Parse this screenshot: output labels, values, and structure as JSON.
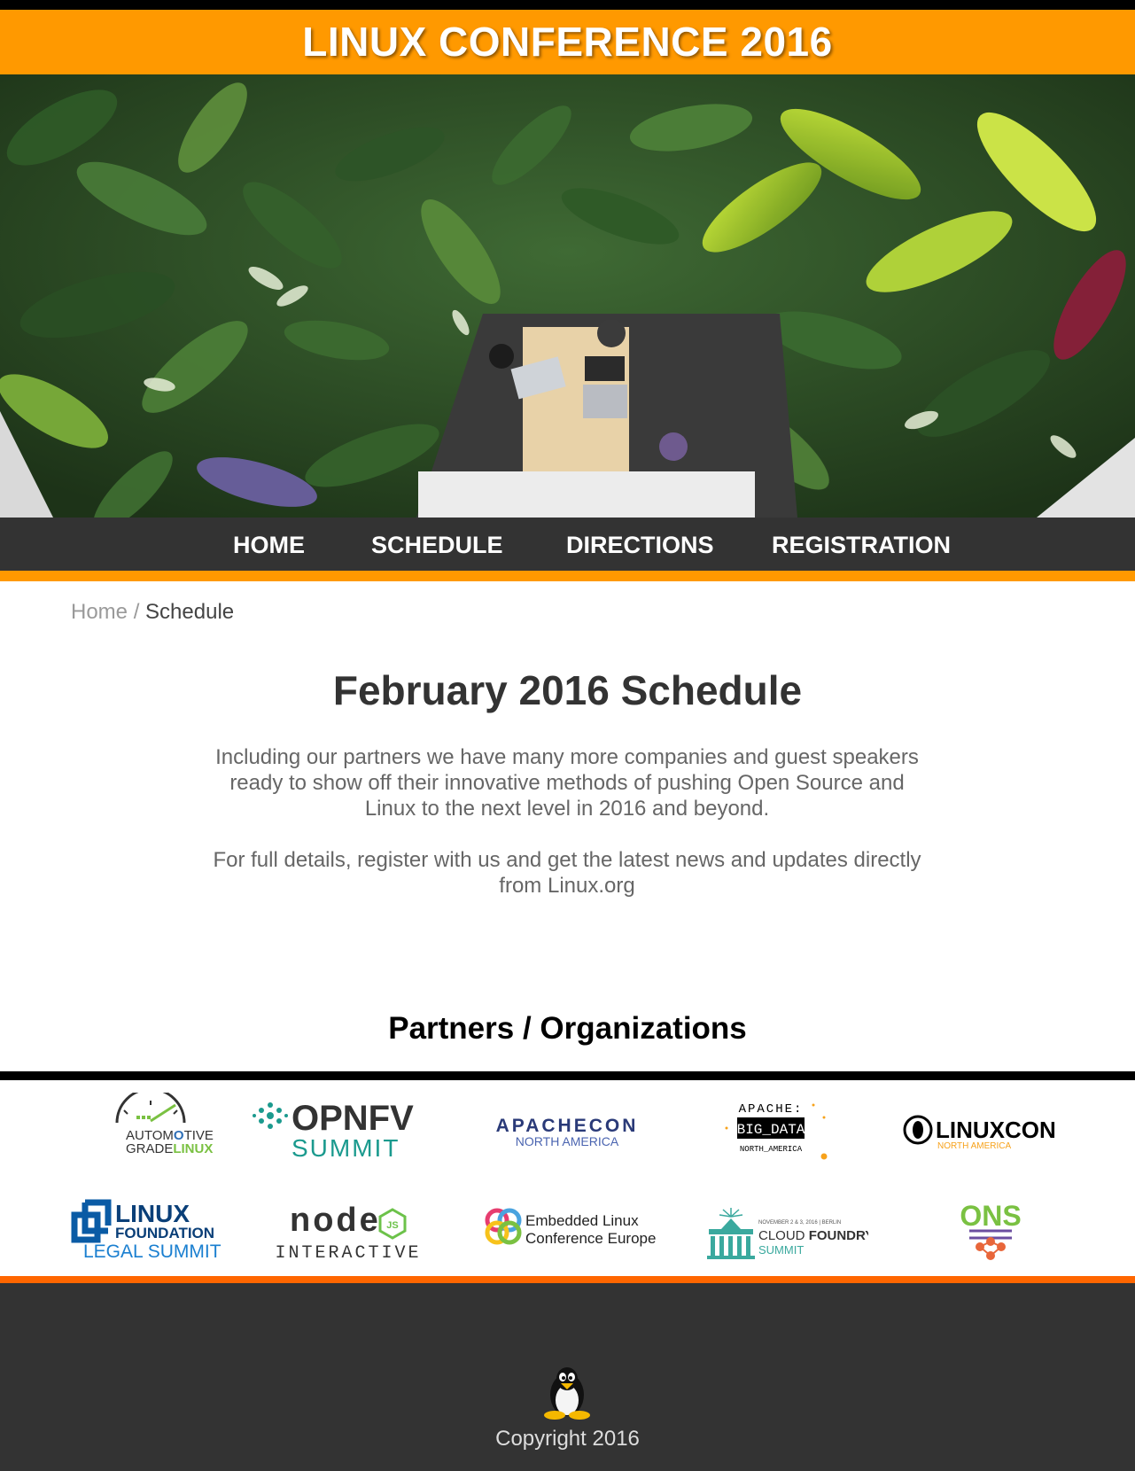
{
  "site": {
    "title": "LINUX CONFERENCE 2016"
  },
  "nav": {
    "items": [
      {
        "label": "HOME"
      },
      {
        "label": "SCHEDULE"
      },
      {
        "label": "DIRECTIONS"
      },
      {
        "label": "REGISTRATION"
      }
    ]
  },
  "breadcrumb": {
    "home": "Home",
    "separator": "/",
    "current": "Schedule"
  },
  "main": {
    "title": "February 2016 Schedule",
    "paragraphs": [
      "Including our partners we have many more companies and guest speakers ready to show off their innovative methods of pushing Open Source and Linux to the next level in 2016 and beyond.",
      "For full details, register with us and get the latest news and updates directly from Linux.org"
    ]
  },
  "partners": {
    "title": "Partners / Organizations",
    "logos": {
      "agl": {
        "line1a": "AUTOM",
        "line1b": "TIVE",
        "line2a": "GRADE",
        "line2b": "LINUX"
      },
      "opnfv": {
        "line1": "OPNFV",
        "line2": "SUMMIT"
      },
      "apachecon": {
        "line1": "APACHECON",
        "line2": "NORTH AMERICA"
      },
      "bigdata": {
        "line1": "APACHE:",
        "line2": "BIG_DATA",
        "line3": "NORTH_AMERICA"
      },
      "linuxcon": {
        "line1": "LINUXCON",
        "line2": "NORTH AMERICA"
      },
      "lf_legal": {
        "line1": "LINUX",
        "line2": "FOUNDATION",
        "line3": "LEGAL SUMMIT"
      },
      "node": {
        "line1": "node",
        "badge": "JS",
        "line2": "INTERACTIVE"
      },
      "elce": {
        "line1": "Embedded Linux",
        "line2": "Conference Europe"
      },
      "cloudfoundry": {
        "date": "NOVEMBER 2 & 3, 2016  |  BERLIN",
        "line1a": "CLOUD ",
        "line1b": "FOUNDRY",
        "line2": "SUMMIT"
      },
      "ons": {
        "line1": "ONS"
      }
    }
  },
  "footer": {
    "copyright": "Copyright 2016"
  },
  "colors": {
    "orange": "#ff9900",
    "footer_orange": "#ff6600",
    "dark": "#333333",
    "black": "#000000"
  }
}
